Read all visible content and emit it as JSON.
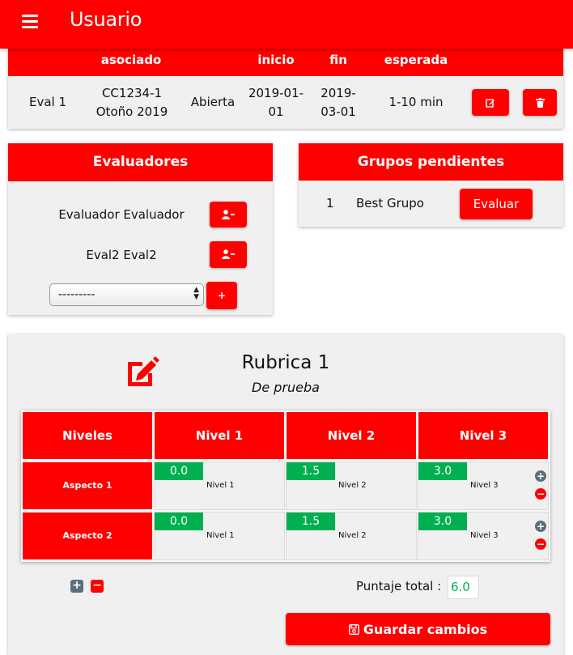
{
  "app": {
    "title": "Usuario"
  },
  "eval_table": {
    "columns": [
      "asociado",
      "inicio",
      "fin",
      "esperada"
    ],
    "row": {
      "name": "Eval 1",
      "curso_line1": "CC1234-1",
      "curso_line2": "Otoño 2019",
      "estado": "Abierta",
      "inicio_line1": "2019-01-",
      "inicio_line2": "01",
      "fin_line1": "2019-",
      "fin_line2": "03-01",
      "duracion": "1-10 min"
    },
    "actions": {
      "edit_icon": "edit-icon",
      "delete_icon": "trash-icon"
    }
  },
  "evaluadores": {
    "title": "Evaluadores",
    "items": [
      "Evaluador Evaluador",
      "Eval2 Eval2"
    ],
    "remove_icon": "user-minus-icon",
    "select_value": "---------",
    "add_label": "+"
  },
  "grupos": {
    "title": "Grupos pendientes",
    "row": {
      "num": "1",
      "name": "Best Grupo",
      "action": "Evaluar"
    }
  },
  "rubrica": {
    "title": "Rubrica 1",
    "subtitle": "De prueba",
    "header_first": "Niveles",
    "levels": [
      "Nivel 1",
      "Nivel 2",
      "Nivel 3"
    ],
    "aspects": [
      {
        "name": "Aspecto 1",
        "scores": [
          "0.0",
          "1.5",
          "3.0"
        ],
        "labels": [
          "Nivel 1",
          "Nivel 2",
          "Nivel 3"
        ]
      },
      {
        "name": "Aspecto 2",
        "scores": [
          "0.0",
          "1.5",
          "3.0"
        ],
        "labels": [
          "Nivel 1",
          "Nivel 2",
          "Nivel 3"
        ]
      }
    ],
    "total_label": "Puntaje total :",
    "total_value": "6.0",
    "save_label": "Guardar cambios"
  },
  "colors": {
    "accent": "#ff0000",
    "score": "#00b050",
    "card": "#f0f0f0",
    "add_circle": "#5a6e7c"
  }
}
